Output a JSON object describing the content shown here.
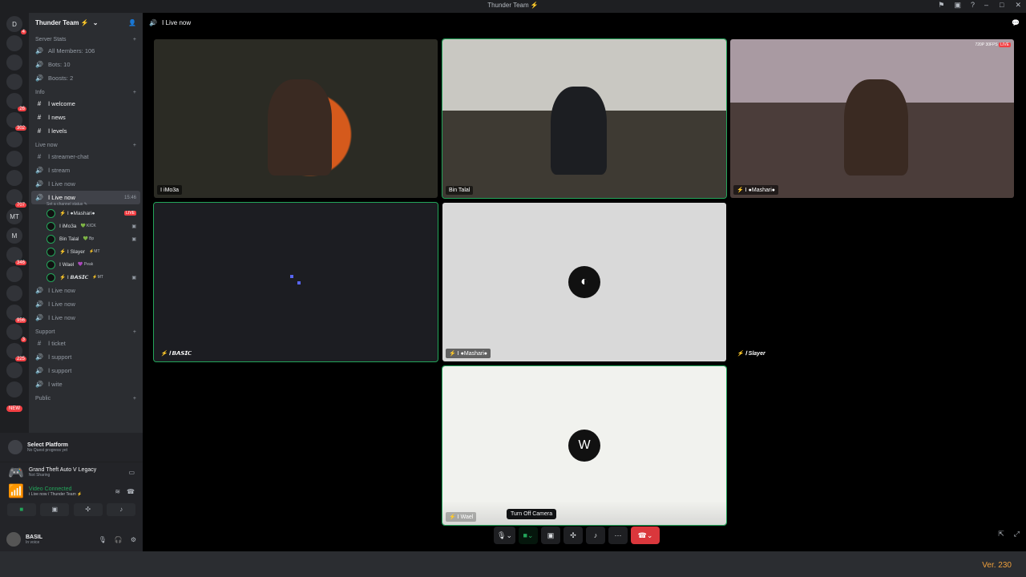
{
  "window": {
    "title": "Thunder Team ⚡"
  },
  "servers": [
    {
      "label": "D",
      "badge": "4"
    },
    {
      "label": "",
      "badge": ""
    },
    {
      "label": "",
      "badge": ""
    },
    {
      "label": "",
      "badge": ""
    },
    {
      "label": "",
      "badge": "26"
    },
    {
      "label": "",
      "badge": "302"
    },
    {
      "label": "",
      "badge": ""
    },
    {
      "label": "",
      "badge": ""
    },
    {
      "label": "",
      "badge": ""
    },
    {
      "label": "",
      "badge": "707"
    },
    {
      "label": "MT",
      "badge": ""
    },
    {
      "label": "M",
      "badge": ""
    },
    {
      "label": "",
      "badge": "346"
    },
    {
      "label": "",
      "badge": ""
    },
    {
      "label": "",
      "badge": ""
    },
    {
      "label": "",
      "badge": "956"
    },
    {
      "label": "",
      "badge": "3"
    },
    {
      "label": "",
      "badge": "225"
    },
    {
      "label": "",
      "badge": ""
    },
    {
      "label": "",
      "badge": ""
    }
  ],
  "new_badge": "NEW",
  "guild": {
    "name": "Thunder Team ⚡"
  },
  "categories": {
    "server_stats": "Server Stats",
    "info": "Info",
    "live_now": "Live now",
    "support": "Support",
    "public": "Public"
  },
  "stats": [
    "All Members: 106",
    "Bots: 10",
    "Boosts: 2"
  ],
  "info_channels": [
    "ꓲ welcome",
    "ꓲ news",
    "ꓲ levels"
  ],
  "live_channels": [
    "ꓲ streamer-chat",
    "ꓲ stream",
    "ꓲ Live now"
  ],
  "active_channel": {
    "name": "ꓲ Live now",
    "time": "15:46",
    "status": "Set a channel status ✎"
  },
  "voice_users": [
    {
      "name": "⚡ ꓲ ●Mashari●",
      "tag": "",
      "badge": "LIVE"
    },
    {
      "name": "ꓲ iMo3a",
      "tag": "💚 KICK",
      "badge": "▣"
    },
    {
      "name": "Bin Talal",
      "tag": "💚 Bp",
      "badge": "▣"
    },
    {
      "name": "⚡ ꓲ Slayer",
      "tag": "⚡MT",
      "badge": ""
    },
    {
      "name": "ꓲ Wael",
      "tag": "💜 Peak",
      "badge": ""
    },
    {
      "name": "⚡ ꓲ 𝘽𝘼𝙎𝙄𝘾",
      "tag": "⚡MT",
      "badge": "▣"
    }
  ],
  "more_live": [
    "ꓲ Live now",
    "ꓲ Live now",
    "ꓲ Live now"
  ],
  "support_channels": [
    "ꓲ ticket",
    "ꓲ support",
    "ꓲ support",
    "ꓲ wite"
  ],
  "quest": {
    "title": "Select Platform",
    "subtitle": "No Quest progress yet"
  },
  "activity": {
    "game": "Grand Theft Auto V Legacy",
    "status": "Not Sharing"
  },
  "voice": {
    "status": "Video Connected",
    "location": "ꓲ Live now / Thunder Team ⚡"
  },
  "user": {
    "name": "BASIL",
    "status": "In voice"
  },
  "stage": {
    "channel": "ꓲ Live now"
  },
  "tiles": [
    {
      "name": "ꓲ iMo3a",
      "style": "cam"
    },
    {
      "name": "Bin Talal",
      "style": "cam"
    },
    {
      "name": "⚡ ꓲ ●Mashari●",
      "style": "cam",
      "badge": "720P 30FPS",
      "live": "LIVE"
    },
    {
      "name": "⚡ ꓲ 𝘽𝘼𝙎𝙄𝘾",
      "style": "dark"
    },
    {
      "name": "⚡ ꓲ ●Mashari●",
      "style": "light"
    },
    {
      "name": "⚡ ꓲ Slayer",
      "style": "black"
    },
    {
      "name": "⚡ ꓲ Wael",
      "style": "cream"
    }
  ],
  "tooltip": "Turn Off Camera",
  "version": "Ver. 230"
}
